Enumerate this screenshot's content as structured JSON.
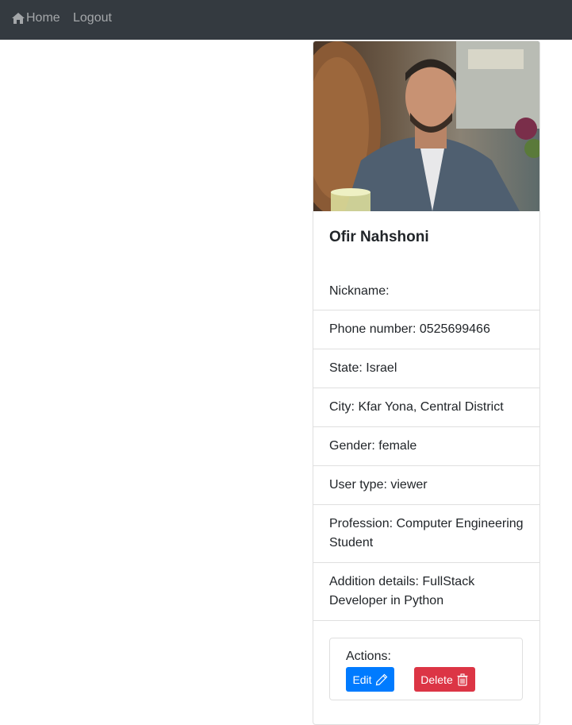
{
  "navbar": {
    "home_label": "Home",
    "home_icon": "home-icon",
    "logout_label": "Logout",
    "background": "#343a40"
  },
  "profile": {
    "name": "Ofir Nahshoni",
    "photo_alt": "profile photo",
    "details": [
      "Nickname:",
      "Phone number: 0525699466",
      "State: Israel",
      "City: Kfar Yona, Central District",
      "Gender: female",
      "User type: viewer",
      "Profession: Computer Engineering Student",
      "Addition details: FullStack Developer in Python"
    ]
  },
  "actions": {
    "label": "Actions:",
    "edit_label": "Edit",
    "edit_icon": "pencil-icon",
    "delete_label": "Delete",
    "delete_icon": "trash-icon",
    "edit_color": "#007bff",
    "delete_color": "#dc3545"
  }
}
